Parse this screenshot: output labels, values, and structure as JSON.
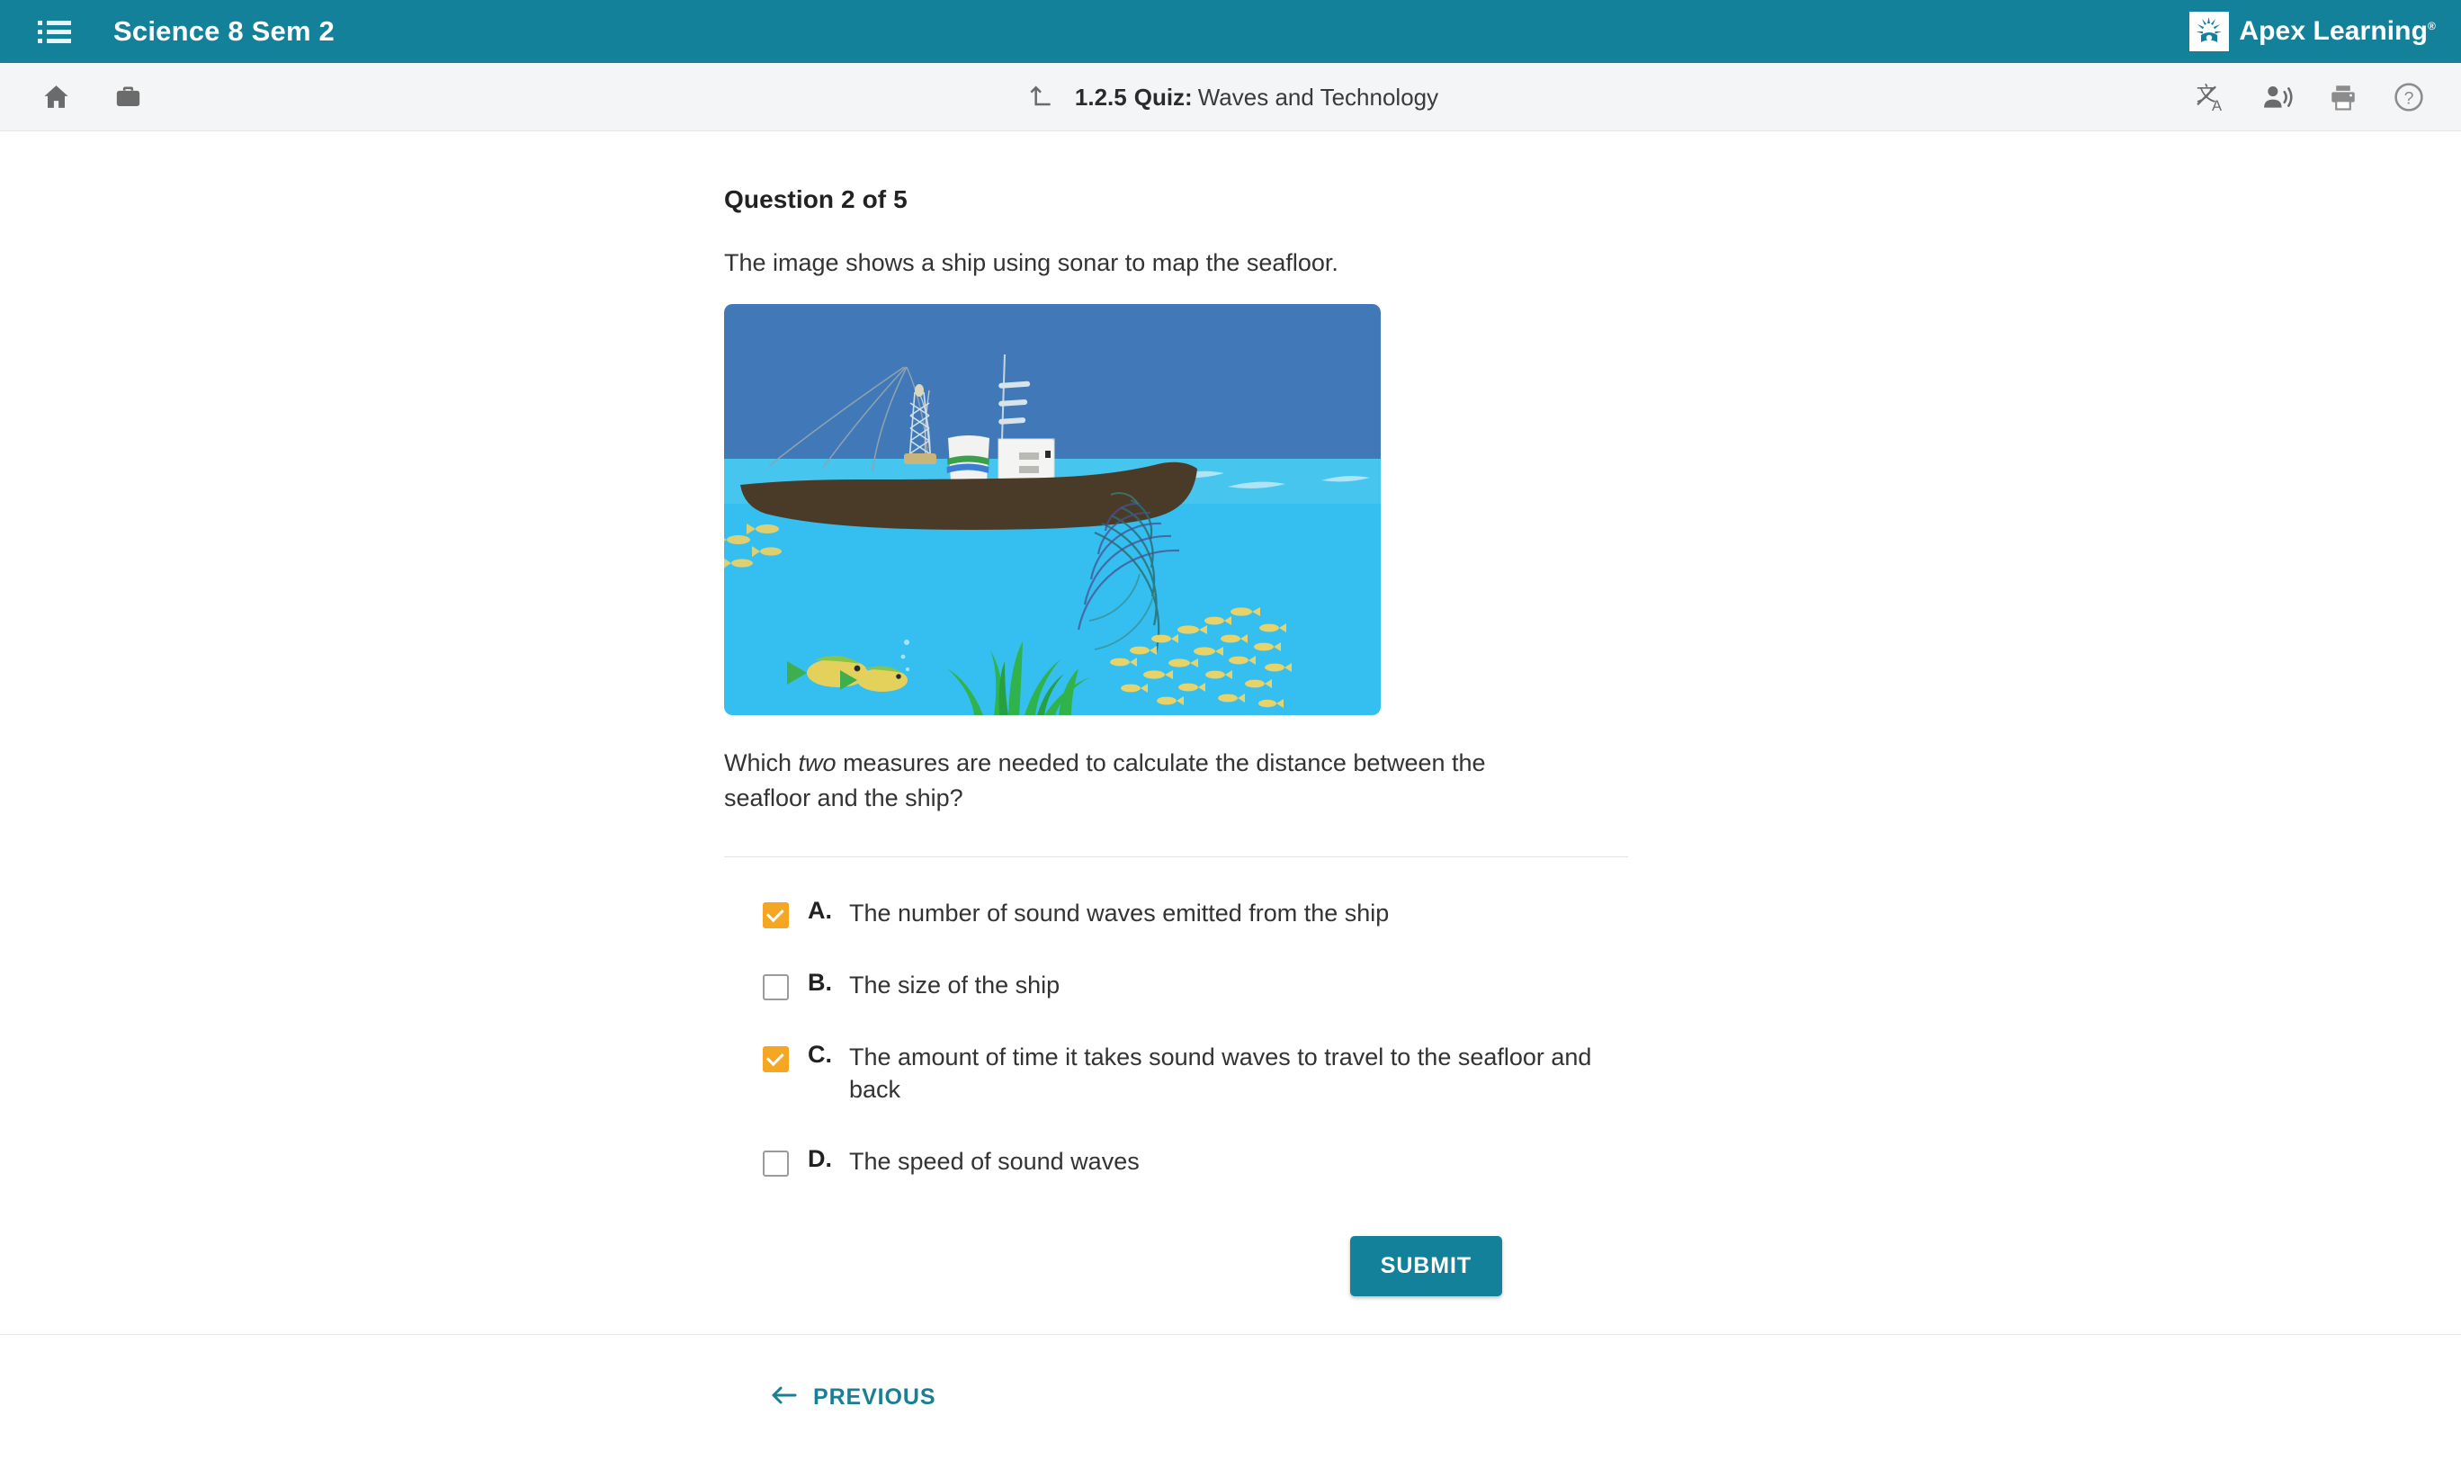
{
  "header": {
    "menu_icon": "list-menu-icon",
    "course_title": "Science 8 Sem 2",
    "brand_name": "Apex Learning",
    "brand_mark_icon": "apex-sunburst-logo-icon",
    "accent_color": "#13819a"
  },
  "toolbar": {
    "home_icon": "home-icon",
    "briefcase_icon": "briefcase-icon",
    "up_arrow_icon": "arrow-up-left-icon",
    "activity_number": "1.2.5",
    "activity_type": "Quiz:",
    "activity_name": "Waves and Technology",
    "translate_icon": "translate-icon",
    "read_aloud_icon": "text-to-speech-icon",
    "print_icon": "print-icon",
    "help_icon": "help-circle-icon"
  },
  "question": {
    "heading": "Question 2 of 5",
    "intro": "The image shows a ship using sonar to map the seafloor.",
    "prompt_before": "Which ",
    "prompt_italic": "two",
    "prompt_after": " measures are needed to calculate the distance between the seafloor and the ship?",
    "figure_alt": "sonar-ship-seafloor-illustration",
    "options": [
      {
        "letter": "A.",
        "text": "The number of sound waves emitted from the ship",
        "checked": true
      },
      {
        "letter": "B.",
        "text": "The size of the ship",
        "checked": false
      },
      {
        "letter": "C.",
        "text": "The amount of time it takes sound waves to travel to the seafloor and back",
        "checked": true
      },
      {
        "letter": "D.",
        "text": "The speed of sound waves",
        "checked": false
      }
    ],
    "checked_color": "#f5a623",
    "submit_label": "SUBMIT"
  },
  "footer": {
    "previous_label": "PREVIOUS",
    "previous_icon": "arrow-left-icon",
    "link_color": "#187f94"
  },
  "figure_colors": {
    "sky": "#4179b8",
    "surface_band": "#46c6ef",
    "water": "#35bef0",
    "hull": "#4a3b28",
    "cabin": "#f2f2f0",
    "fish": "#e8d26a",
    "seaweed": "#2fb34a",
    "sonar": "#2b6f72"
  }
}
